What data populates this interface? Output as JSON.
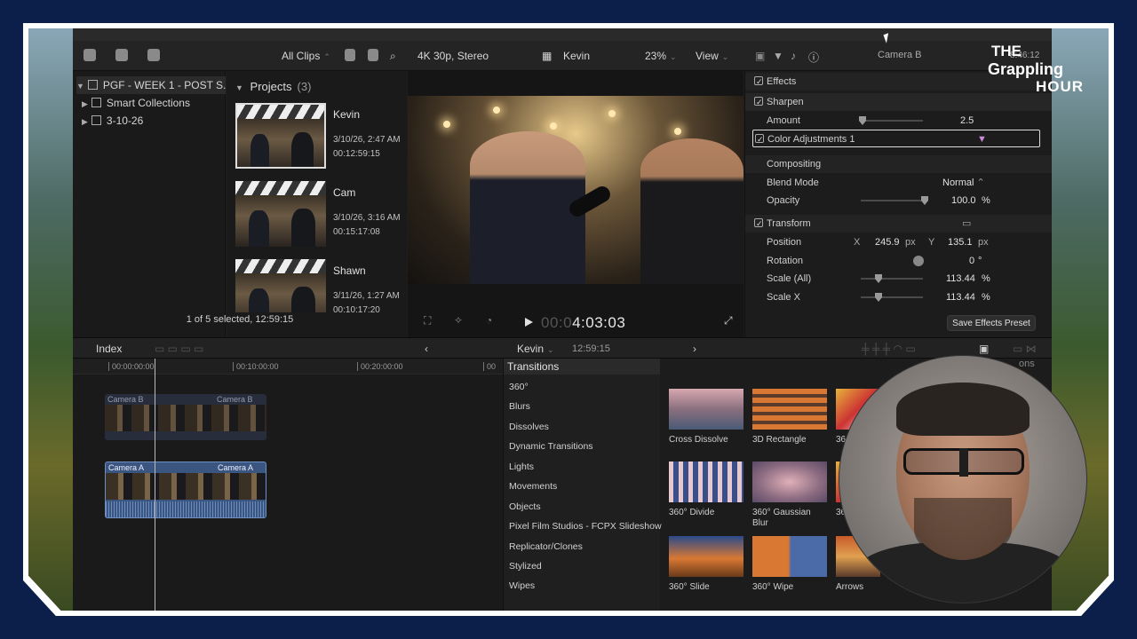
{
  "toolbar": {
    "all_clips": "All Clips",
    "format": "4K 30p, Stereo",
    "project_name": "Kevin",
    "zoom": "23%",
    "view": "View",
    "inspector_title": "Camera B",
    "timecode_corner": "8:46:12"
  },
  "library": {
    "items": [
      {
        "label": "PGF - WEEK 1 - POST S..."
      },
      {
        "label": "Smart Collections"
      },
      {
        "label": "3-10-26"
      }
    ]
  },
  "browser": {
    "projects_label": "Projects",
    "projects_count": "(3)",
    "clips": [
      {
        "name": "Kevin",
        "date": "3/10/26, 2:47 AM",
        "duration": "00:12:59:15"
      },
      {
        "name": "Cam",
        "date": "3/10/26, 3:16 AM",
        "duration": "00:15:17:08"
      },
      {
        "name": "Shawn",
        "date": "3/11/26, 1:27 AM",
        "duration": "00:10:17:20"
      }
    ],
    "selection_status": "1 of 5 selected, 12:59:15"
  },
  "viewer": {
    "timecode_dim": "00:0",
    "timecode": "4:03:03"
  },
  "inspector": {
    "effects": "Effects",
    "sharpen": "Sharpen",
    "amount_label": "Amount",
    "amount_value": "2.5",
    "color_adjustments": "Color Adjustments 1",
    "compositing": "Compositing",
    "blend_mode_label": "Blend Mode",
    "blend_mode_value": "Normal",
    "opacity_label": "Opacity",
    "opacity_value": "100.0",
    "opacity_unit": "%",
    "transform": "Transform",
    "position_label": "Position",
    "position_x_label": "X",
    "position_x_value": "245.9",
    "position_y_label": "Y",
    "position_y_value": "135.1",
    "px_unit": "px",
    "rotation_label": "Rotation",
    "rotation_value": "0",
    "rotation_unit": "°",
    "scale_all_label": "Scale (All)",
    "scale_all_value": "113.44",
    "scale_x_label": "Scale X",
    "scale_x_value": "113.44",
    "percent_unit": "%",
    "save_preset": "Save Effects Preset"
  },
  "timeline_header": {
    "index": "Index",
    "project": "Kevin",
    "duration": "12:59:15"
  },
  "timeline": {
    "ruler": [
      "00:00:00:00",
      "00:10:00:00",
      "00:20:00:00",
      "00"
    ],
    "camera_b": "Camera B",
    "camera_a": "Camera A"
  },
  "transitions": {
    "title": "Transitions",
    "categories": [
      "360°",
      "Blurs",
      "Dissolves",
      "Dynamic Transitions",
      "Lights",
      "Movements",
      "Objects",
      "Pixel Film Studios - FCPX Slideshow",
      "Replicator/Clones",
      "Stylized",
      "Wipes"
    ],
    "tiles": [
      {
        "label": "Cross Dissolve"
      },
      {
        "label": "3D Rectangle"
      },
      {
        "label": "36"
      },
      {
        "label": "360° Divide"
      },
      {
        "label": "360° Gaussian Blur"
      },
      {
        "label": "36"
      },
      {
        "label": "360° Slide"
      },
      {
        "label": "360° Wipe"
      },
      {
        "label": "Arrows"
      }
    ],
    "options_fragment": "ons"
  },
  "logo": {
    "line1": "THE",
    "line2": "Grappling",
    "line3": "HOUR"
  }
}
